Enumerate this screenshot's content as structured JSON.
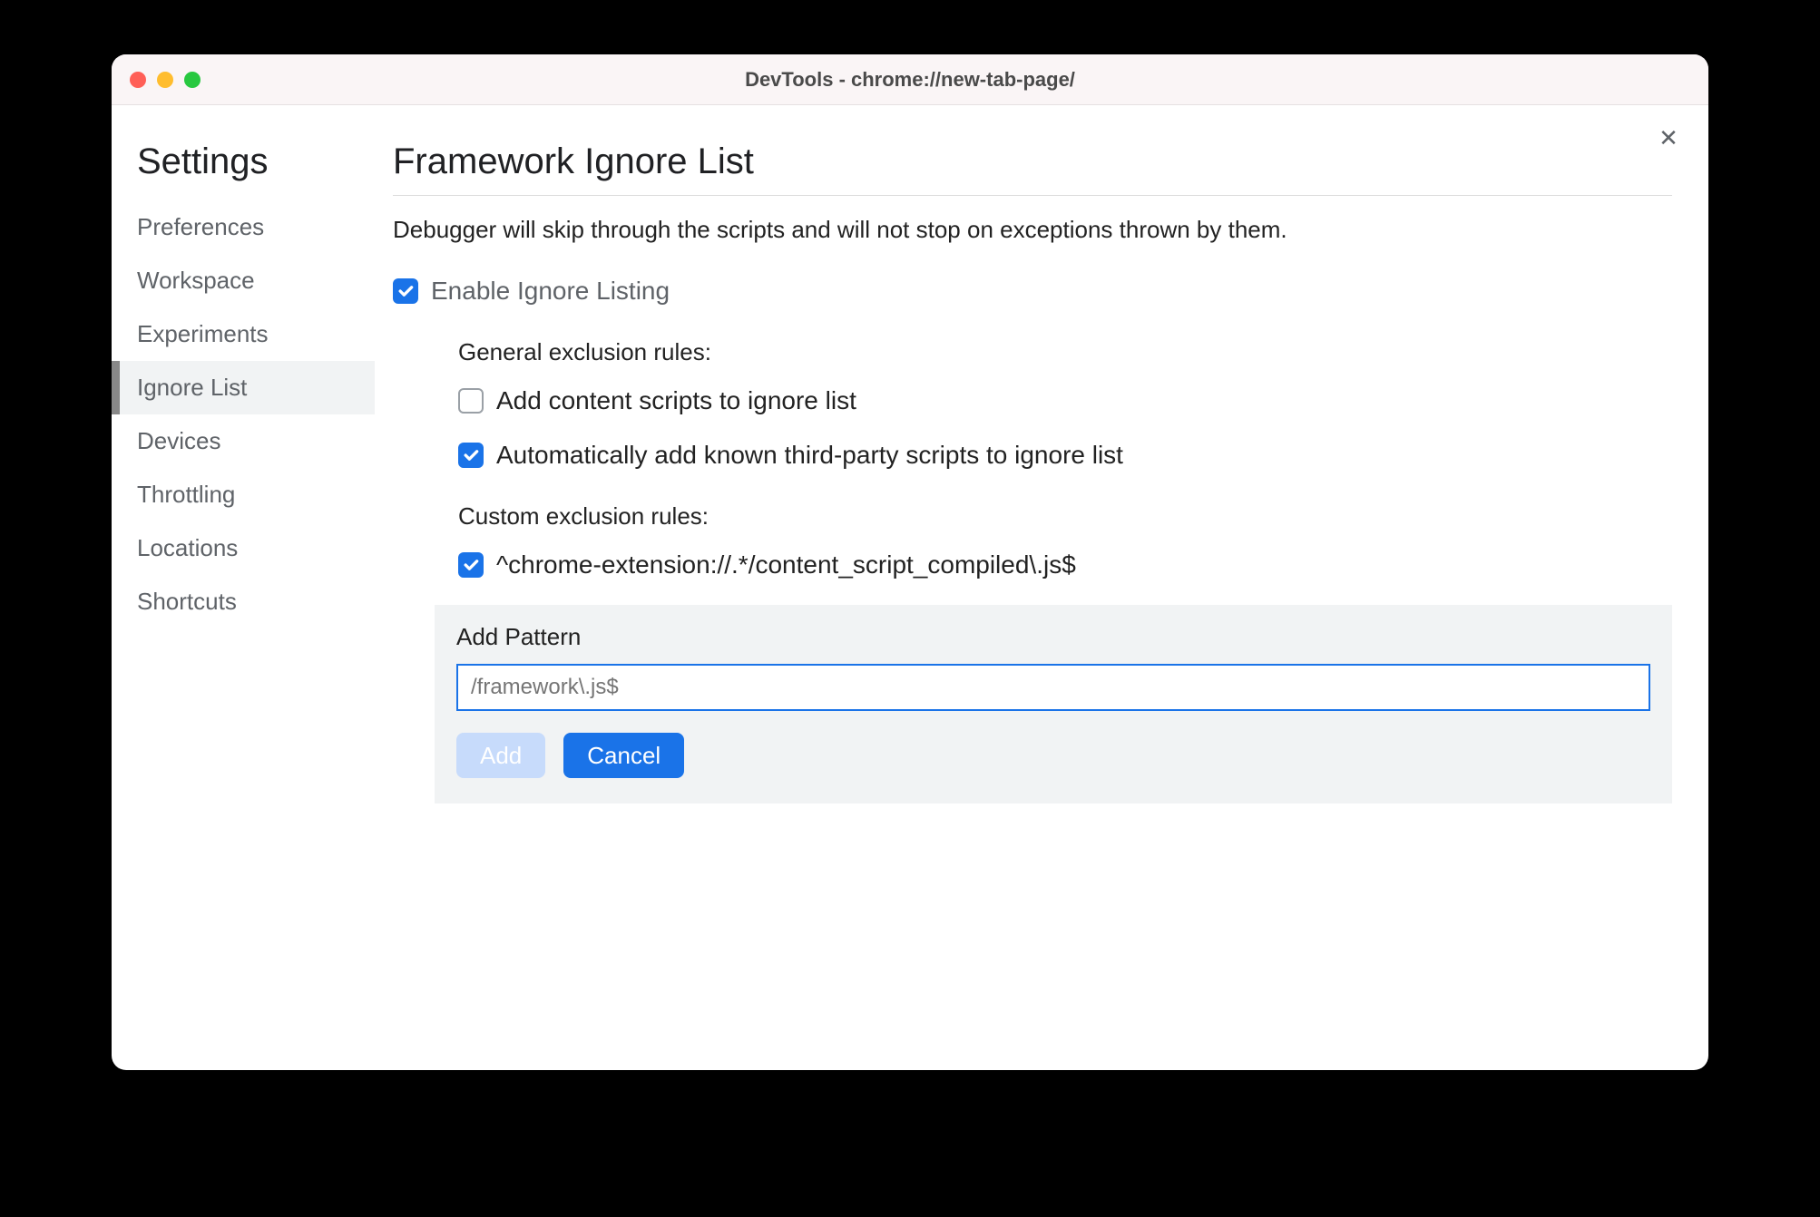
{
  "window": {
    "title": "DevTools - chrome://new-tab-page/"
  },
  "sidebar": {
    "heading": "Settings",
    "items": [
      {
        "label": "Preferences"
      },
      {
        "label": "Workspace"
      },
      {
        "label": "Experiments"
      },
      {
        "label": "Ignore List"
      },
      {
        "label": "Devices"
      },
      {
        "label": "Throttling"
      },
      {
        "label": "Locations"
      },
      {
        "label": "Shortcuts"
      }
    ]
  },
  "main": {
    "heading": "Framework Ignore List",
    "description": "Debugger will skip through the scripts and will not stop on exceptions thrown by them.",
    "enable_label": "Enable Ignore Listing",
    "general_heading": "General exclusion rules:",
    "rule_content_scripts": "Add content scripts to ignore list",
    "rule_third_party": "Automatically add known third-party scripts to ignore list",
    "custom_heading": "Custom exclusion rules:",
    "custom_rule_1": "^chrome-extension://.*/content_script_compiled\\.js$",
    "add_pattern_label": "Add Pattern",
    "add_pattern_placeholder": "/framework\\.js$",
    "add_button": "Add",
    "cancel_button": "Cancel"
  }
}
